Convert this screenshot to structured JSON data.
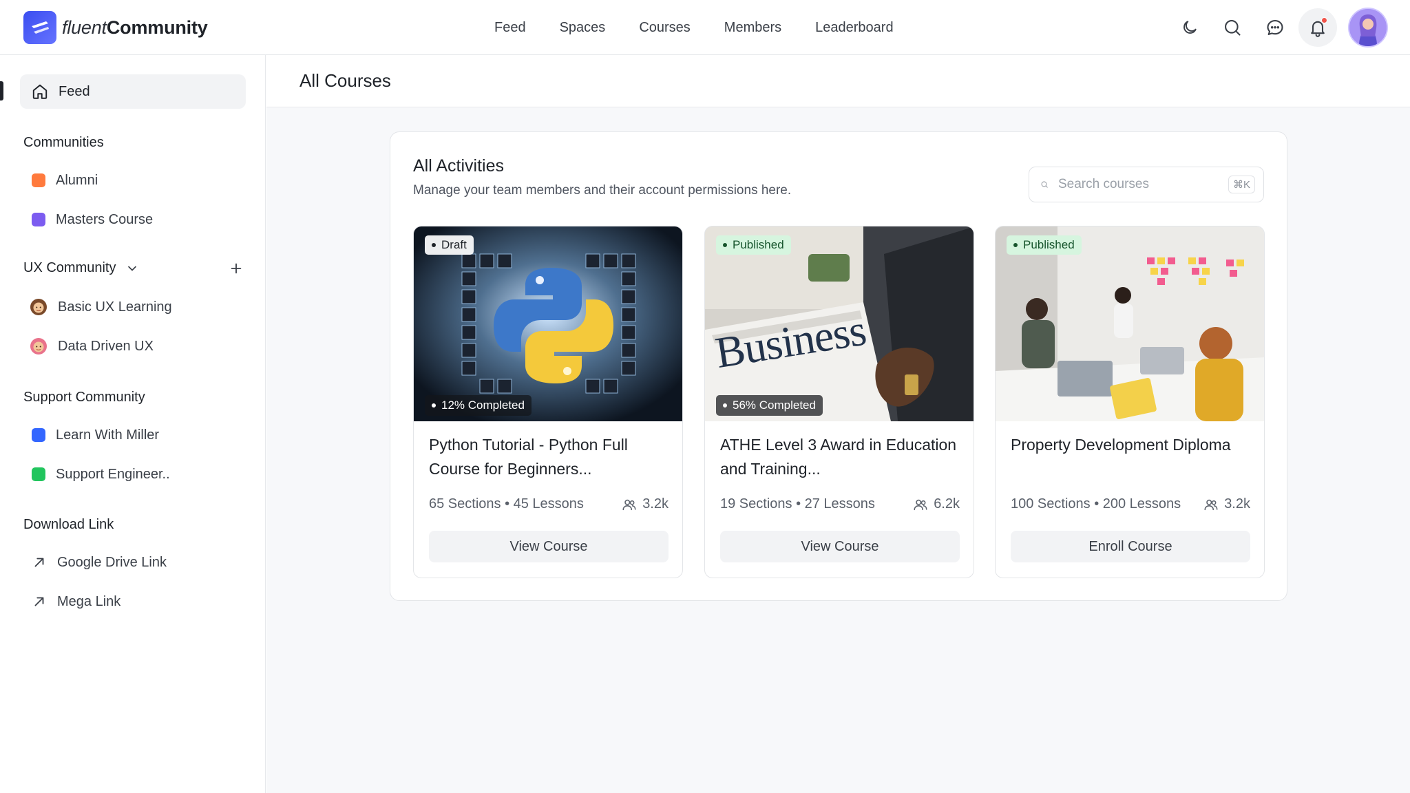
{
  "brand": {
    "name_light": "fluent",
    "name_bold": "Community"
  },
  "topnav": [
    "Feed",
    "Spaces",
    "Courses",
    "Members",
    "Leaderboard"
  ],
  "sidebar": {
    "feed_label": "Feed",
    "communities_title": "Communities",
    "communities": [
      {
        "label": "Alumni",
        "color": "#ff7a3d"
      },
      {
        "label": "Masters Course",
        "color": "#7c5cf0"
      }
    ],
    "ux_title": "UX Community",
    "ux_items": [
      {
        "label": "Basic UX Learning"
      },
      {
        "label": "Data Driven UX"
      }
    ],
    "support_title": "Support Community",
    "support_items": [
      {
        "label": "Learn With Miller",
        "color": "#3366ff"
      },
      {
        "label": "Support Engineer..",
        "color": "#22c55e"
      }
    ],
    "download_title": "Download Link",
    "download_items": [
      {
        "label": "Google Drive Link"
      },
      {
        "label": "Mega Link"
      }
    ]
  },
  "main": {
    "page_title": "All Courses",
    "panel_title": "All Activities",
    "panel_subtitle": "Manage your team members and their account permissions here.",
    "search_placeholder": "Search courses",
    "search_shortcut": "⌘K"
  },
  "courses": [
    {
      "status": "Draft",
      "progress": "12% Completed",
      "title": "Python Tutorial - Python Full Course for Beginners...",
      "meta": "65 Sections • 45 Lessons",
      "members": "3.2k",
      "button": "View Course"
    },
    {
      "status": "Published",
      "progress": "56% Completed",
      "title": "ATHE Level 3 Award in Education and Training...",
      "meta": "19 Sections • 27 Lessons",
      "members": "6.2k",
      "button": "View Course"
    },
    {
      "status": "Published",
      "progress": "",
      "title": "Property Development Diploma",
      "meta": "100 Sections • 200 Lessons",
      "members": "3.2k",
      "button": "Enroll Course"
    }
  ],
  "thumb_text": {
    "business": "Business"
  }
}
